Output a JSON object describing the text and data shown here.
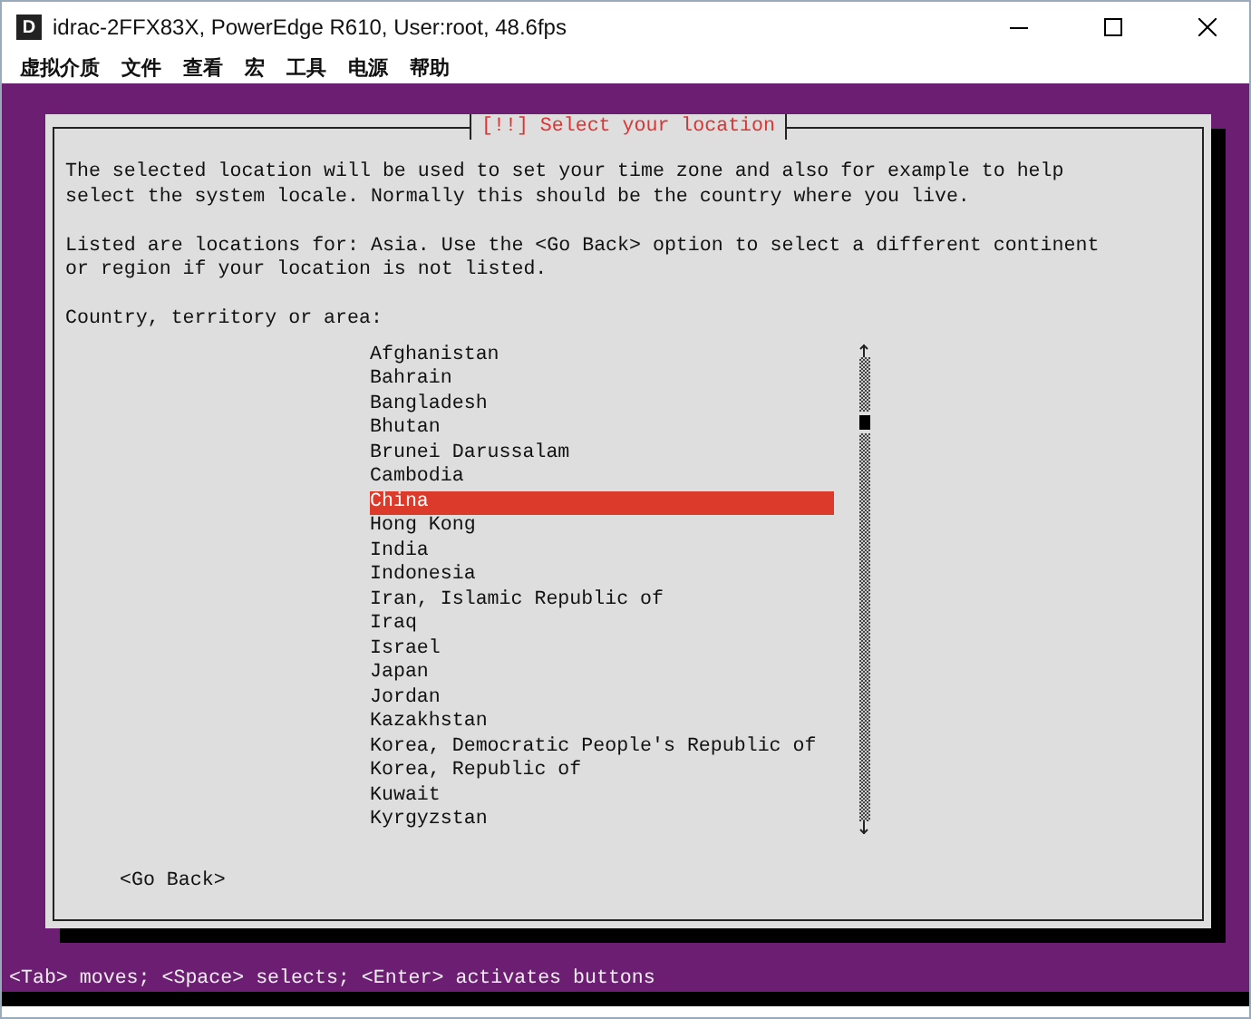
{
  "window": {
    "app_icon": "D",
    "title": "idrac-2FFX83X, PowerEdge R610, User:root, 48.6fps"
  },
  "menu": [
    "虚拟介质",
    "文件",
    "查看",
    "宏",
    "工具",
    "电源",
    "帮助"
  ],
  "dialog": {
    "title": "[!!] Select your location",
    "paragraphs": [
      "The selected location will be used to set your time zone and also for example to help\nselect the system locale. Normally this should be the country where you live.",
      "Listed are locations for: Asia. Use the <Go Back> option to select a different continent\nor region if your location is not listed."
    ],
    "prompt": "Country, territory or area:",
    "items": [
      {
        "label": "Afghanistan",
        "selected": false
      },
      {
        "label": "Bahrain",
        "selected": false
      },
      {
        "label": "Bangladesh",
        "selected": false
      },
      {
        "label": "Bhutan",
        "selected": false
      },
      {
        "label": "Brunei Darussalam",
        "selected": false
      },
      {
        "label": "Cambodia",
        "selected": false
      },
      {
        "label": "China",
        "selected": true
      },
      {
        "label": "Hong Kong",
        "selected": false
      },
      {
        "label": "India",
        "selected": false
      },
      {
        "label": "Indonesia",
        "selected": false
      },
      {
        "label": "Iran, Islamic Republic of",
        "selected": false
      },
      {
        "label": "Iraq",
        "selected": false
      },
      {
        "label": "Israel",
        "selected": false
      },
      {
        "label": "Japan",
        "selected": false
      },
      {
        "label": "Jordan",
        "selected": false
      },
      {
        "label": "Kazakhstan",
        "selected": false
      },
      {
        "label": "Korea, Democratic People's Republic of",
        "selected": false
      },
      {
        "label": "Korea, Republic of",
        "selected": false
      },
      {
        "label": "Kuwait",
        "selected": false
      },
      {
        "label": "Kyrgyzstan",
        "selected": false
      }
    ],
    "go_back": "<Go Back>"
  },
  "status_line": "<Tab> moves; <Space> selects; <Enter> activates buttons"
}
